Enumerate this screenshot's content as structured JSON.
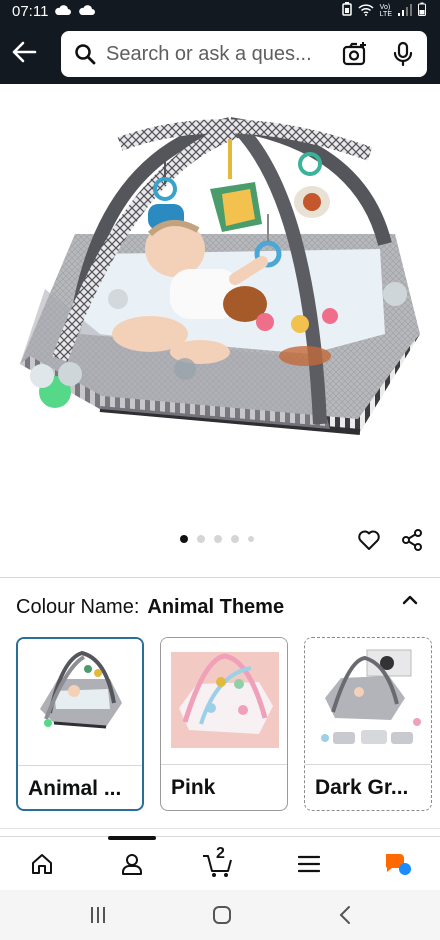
{
  "status_bar": {
    "time": "07:11",
    "network_label": "Vo)\nLTE"
  },
  "search": {
    "placeholder": "Search or ask a ques..."
  },
  "gallery": {
    "dot_count": 5,
    "active_index": 0
  },
  "colour": {
    "label": "Colour Name:",
    "selected": "Animal Theme",
    "options": [
      {
        "name": "Animal ..."
      },
      {
        "name": "Pink"
      },
      {
        "name": "Dark Gr..."
      }
    ]
  },
  "bottom_nav": {
    "cart_count": "2"
  },
  "colors": {
    "header_bg": "#131921",
    "selected_border": "#2a6f97",
    "rufus_orange": "#ff6a00",
    "rufus_blue": "#1a8cff"
  }
}
